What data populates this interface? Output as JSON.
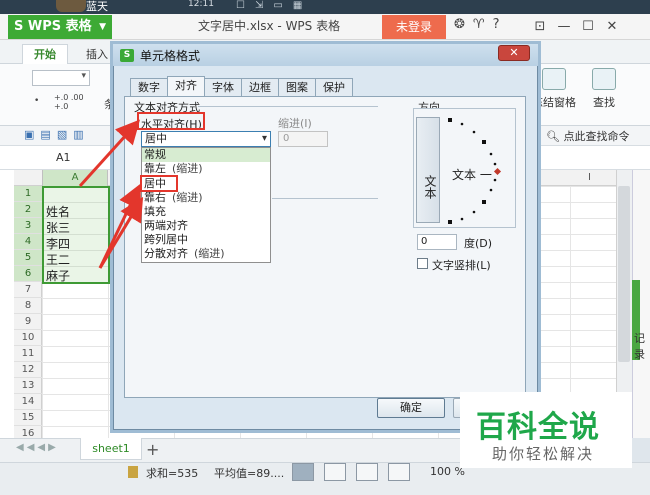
{
  "topstrip": {
    "user": "蓝天",
    "time": "12:11"
  },
  "titlebar": {
    "app_label": "WPS 表格",
    "doc_title": "文字居中.xlsx - WPS 表格",
    "login_label": "未登录"
  },
  "ribbon": {
    "tabs": [
      "开始",
      "插入"
    ],
    "tiao_label": "条",
    "pct_labels": [
      "+.0",
      ".00",
      "+.0"
    ],
    "freeze_label": "冻结窗格",
    "find_label": "查找"
  },
  "quickbar": {
    "find_command": "点此查找命令"
  },
  "formula": {
    "cell_ref": "A1"
  },
  "sheet": {
    "col_a": "A",
    "col_i": "I",
    "rows": [
      "1",
      "2",
      "3",
      "4",
      "5",
      "6",
      "7",
      "8",
      "9",
      "10",
      "11",
      "12",
      "13",
      "14",
      "15",
      "16"
    ],
    "cells": [
      "姓名",
      "张三",
      "李四",
      "王二",
      "麻子"
    ],
    "col_b_partial": [
      "语",
      "",
      "",
      "非",
      ""
    ],
    "side_text": "记录"
  },
  "tabs": {
    "sheet1": "sheet1",
    "add": "+"
  },
  "status": {
    "sum": "求和=535",
    "avg": "平均值=89....",
    "zoom": "100 %"
  },
  "dialog": {
    "title": "单元格格式",
    "tabs": [
      "数字",
      "对齐",
      "字体",
      "边框",
      "图案",
      "保护"
    ],
    "active_tab": "对齐",
    "group_align": "文本对齐方式",
    "horizontal_label": "水平对齐(H)",
    "horizontal_value": "居中",
    "indent_label": "缩进(I)",
    "indent_value": "0",
    "options": [
      {
        "label": "常规",
        "note": ""
      },
      {
        "label": "靠左",
        "note": "(缩进)"
      },
      {
        "label": "居中",
        "note": ""
      },
      {
        "label": "靠右",
        "note": "(缩进)"
      },
      {
        "label": "填充",
        "note": ""
      },
      {
        "label": "两端对齐",
        "note": ""
      },
      {
        "label": "跨列居中",
        "note": ""
      },
      {
        "label": "分散对齐",
        "note": "(缩进)"
      }
    ],
    "direction_label": "方向",
    "vertical_text": "文本",
    "direction_text": "文本 一",
    "degree_value": "0",
    "degree_label": "度(D)",
    "vertical_checkbox_label": "文字竖排(L)",
    "ok_label": "确定"
  },
  "watermark": {
    "title": "百科全说",
    "subtitle": "助你轻松解决"
  },
  "colors": {
    "wps_green": "#3daa35",
    "login_orange": "#ee6b4d",
    "highlight_red": "#e3362c",
    "watermark_green": "#1fa74a"
  }
}
